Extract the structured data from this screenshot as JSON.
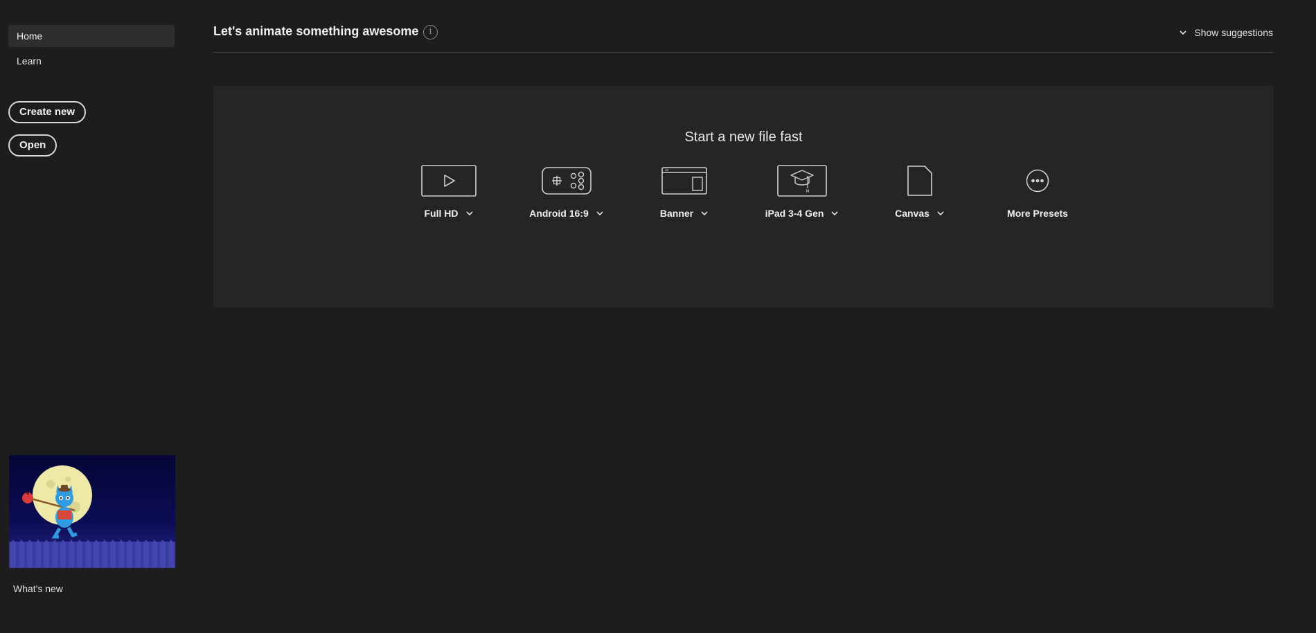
{
  "sidebar": {
    "items": [
      {
        "label": "Home",
        "active": true
      },
      {
        "label": "Learn",
        "active": false
      }
    ],
    "create_new_label": "Create new",
    "open_label": "Open",
    "whats_new_label": "What's new"
  },
  "header": {
    "title": "Let's animate something awesome",
    "suggestions_label": "Show suggestions"
  },
  "panel": {
    "title": "Start a new file fast",
    "presets": [
      {
        "label": "Full HD",
        "icon": "video-play-icon",
        "has_dropdown": true
      },
      {
        "label": "Android 16:9",
        "icon": "gamepad-icon",
        "has_dropdown": true
      },
      {
        "label": "Banner",
        "icon": "banner-icon",
        "has_dropdown": true
      },
      {
        "label": "iPad 3-4 Gen",
        "icon": "graduation-cap-icon",
        "has_dropdown": true
      },
      {
        "label": "Canvas",
        "icon": "document-icon",
        "has_dropdown": true
      },
      {
        "label": "More Presets",
        "icon": "more-icon",
        "has_dropdown": false
      }
    ]
  },
  "colors": {
    "background": "#1d1d1d",
    "panel": "#252525",
    "active_nav": "#2e2e2e",
    "text": "#e8e8e8"
  }
}
